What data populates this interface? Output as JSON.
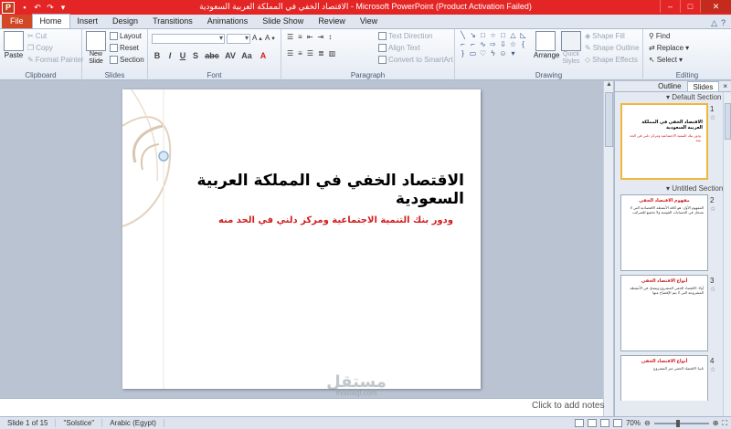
{
  "app": {
    "title": "الاقتصاد الخفي في المملكة العربية السعودية - Microsoft PowerPoint (Product Activation Failed)",
    "icon_letter": "P"
  },
  "tabs": [
    "File",
    "Home",
    "Insert",
    "Design",
    "Transitions",
    "Animations",
    "Slide Show",
    "Review",
    "View"
  ],
  "active_tab": "Home",
  "ribbon": {
    "clipboard": {
      "label": "Clipboard",
      "paste": "Paste",
      "cut": "Cut",
      "copy": "Copy",
      "format_painter": "Format Painter"
    },
    "slides": {
      "label": "Slides",
      "new_slide": "New Slide",
      "layout": "Layout",
      "reset": "Reset",
      "section": "Section"
    },
    "font": {
      "label": "Font",
      "buttons": [
        "B",
        "I",
        "U",
        "S",
        "abc",
        "AV",
        "Aa",
        "A"
      ]
    },
    "paragraph": {
      "label": "Paragraph",
      "text_direction": "Text Direction",
      "align_text": "Align Text",
      "convert_smartart": "Convert to SmartArt"
    },
    "drawing": {
      "label": "Drawing",
      "arrange": "Arrange",
      "quick_styles": "Quick Styles",
      "shape_fill": "Shape Fill",
      "shape_outline": "Shape Outline",
      "shape_effects": "Shape Effects"
    },
    "editing": {
      "label": "Editing",
      "find": "Find",
      "replace": "Replace",
      "select": "Select"
    }
  },
  "slide": {
    "title": "الاقتصاد الخفي في المملكة العربية السعودية",
    "subtitle": "ودور بنك التنمية الاجتماعية ومركز دلني في الحد منه"
  },
  "notes_placeholder": "Click to add notes",
  "watermark": {
    "main": "مستقل",
    "sub": "mostaql.com"
  },
  "pane": {
    "tabs": [
      "Outline",
      "Slides"
    ],
    "active_tab": "Slides",
    "close": "×",
    "sections": [
      "Default Section",
      "Untitled Section"
    ],
    "thumbnails": [
      {
        "num": "1",
        "title": "الاقتصاد الخفي في المملكة العربية السعودية",
        "sub": "ودور بنك التنمية الاجتماعية ومركز دلني في الحد منه",
        "body": ""
      },
      {
        "num": "2",
        "title": "مفهوم الاقتصاد الخفي",
        "sub": "",
        "body": "المفهوم الأول: هو كافة الأنشطة الاقتصادية التي لا تسجل في الحسابات القومية ولا تخضع للضرائب"
      },
      {
        "num": "3",
        "title": "أنواع الاقتصاد الخفي",
        "sub": "",
        "body": "أولا: الاقتصاد الخفي المشروع ويتمثل في الأنشطة المشروعة التي لا يتم الإفصاح عنها"
      },
      {
        "num": "4",
        "title": "أنواع الاقتصاد الخفي",
        "sub": "",
        "body": "ثانيا: الاقتصاد الخفي غير المشروع"
      }
    ]
  },
  "status": {
    "slide_of": "Slide 1 of 15",
    "theme": "\"Solstice\"",
    "language": "Arabic (Egypt)",
    "zoom": "70%"
  },
  "colors": {
    "title_bar": "#e42525",
    "file_tab": "#d24726",
    "subtitle_red": "#d21d1d",
    "selected_thumb": "#f0b73c"
  }
}
